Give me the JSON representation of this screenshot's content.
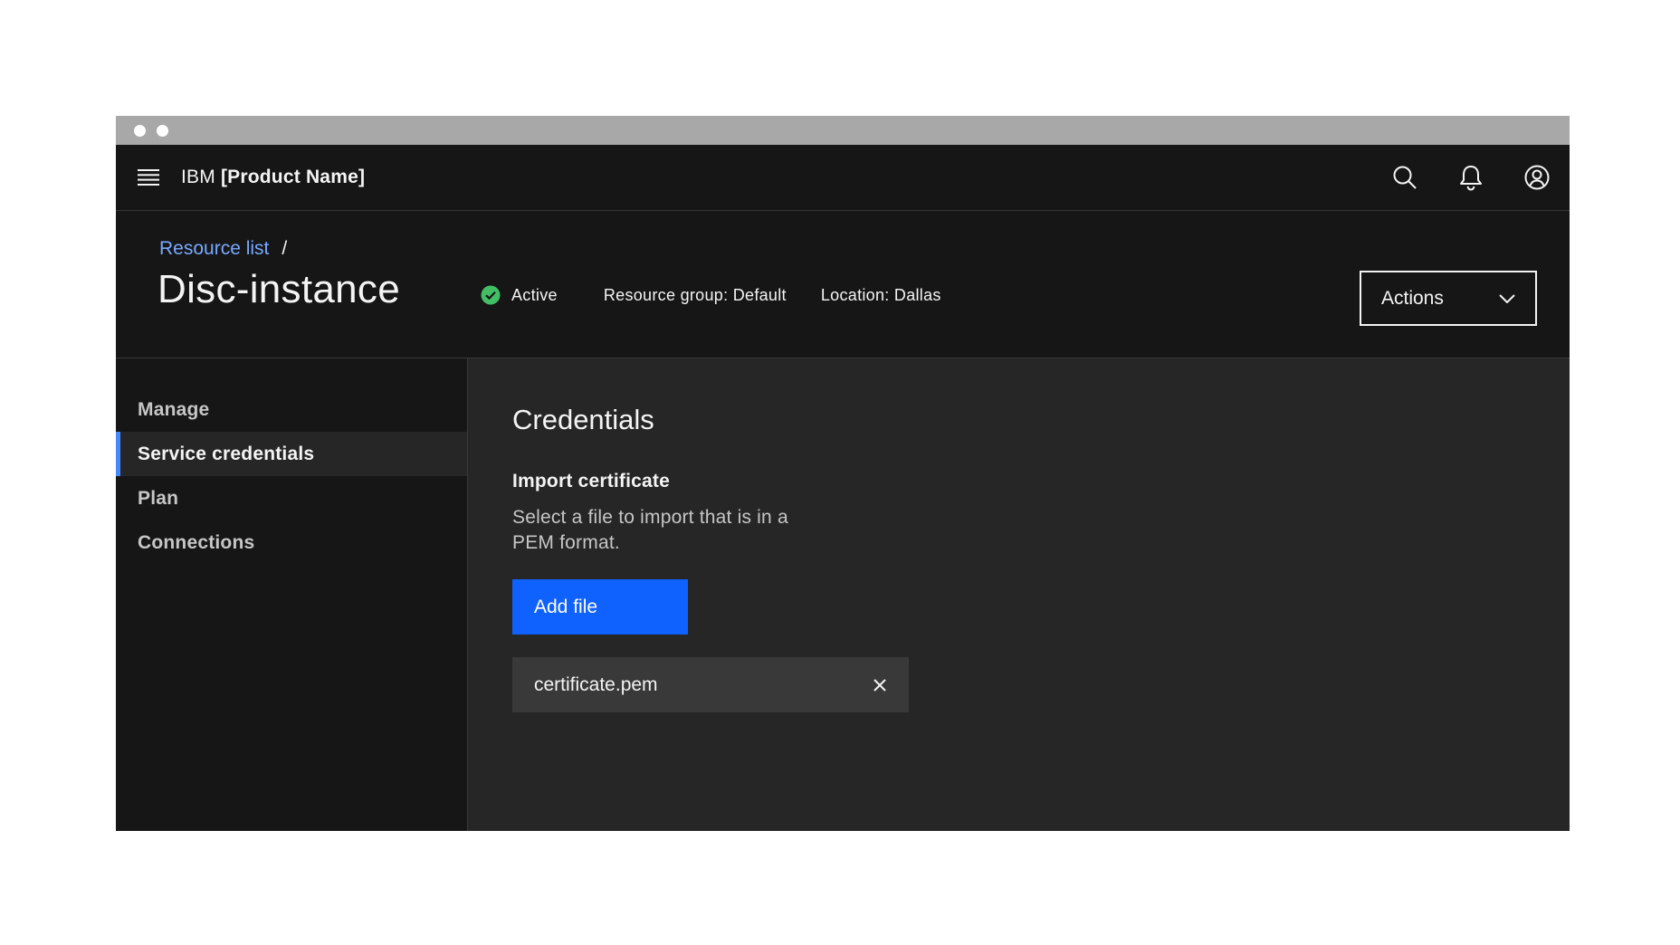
{
  "window": {
    "controls": [
      "dot",
      "dot"
    ]
  },
  "topbar": {
    "brand_prefix": "IBM",
    "brand_product": "[Product Name]",
    "icons": [
      "menu-icon",
      "search-icon",
      "notification-icon",
      "user-avatar-icon"
    ]
  },
  "header": {
    "breadcrumb": {
      "link": "Resource list",
      "separator": "/"
    },
    "title": "Disc-instance",
    "status": {
      "label": "Active",
      "color": "#42be65"
    },
    "resource_group": "Resource group: Default",
    "location": "Location: Dallas",
    "actions_label": "Actions"
  },
  "sidenav": {
    "items": [
      {
        "label": "Manage",
        "active": false
      },
      {
        "label": "Service credentials",
        "active": true
      },
      {
        "label": "Plan",
        "active": false
      },
      {
        "label": "Connections",
        "active": false
      }
    ]
  },
  "main": {
    "section_title": "Credentials",
    "import_label": "Import certificate",
    "helper_text": "Select a file to import that is in a PEM format.",
    "add_button_label": "Add file",
    "file_name": "certificate.pem"
  },
  "colors": {
    "accent": "#0f62fe",
    "link": "#78a9ff",
    "active_indicator": "#4589ff",
    "success": "#42be65"
  }
}
